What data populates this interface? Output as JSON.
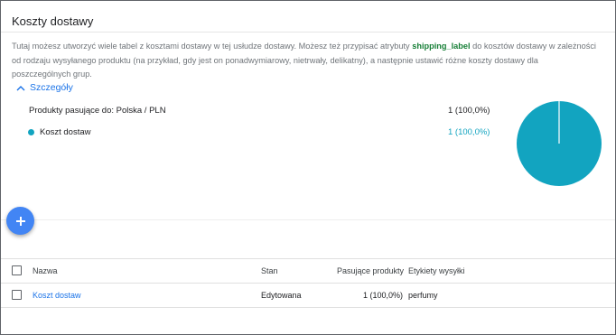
{
  "colors": {
    "accent": "#1a73e8",
    "series": "#12a4c0",
    "fab": "#4285f4",
    "attribute": "#188038"
  },
  "page": {
    "title": "Koszty dostawy",
    "description_before": "Tutaj możesz utworzyć wiele tabel z kosztami dostawy w tej usłudze dostawy. Możesz też przypisać atrybuty ",
    "description_attribute": "shipping_label",
    "description_after": " do kosztów dostawy w zależności od rodzaju wysyłanego produktu (na przykład, gdy jest on ponadwymiarowy, nietrwały, delikatny), a następnie ustawić różne koszty dostawy dla poszczególnych grup."
  },
  "details": {
    "toggle_label": "Szczegóły",
    "toggle_icon": "chevron-up-icon",
    "match_label": "Produkty pasujące do: Polska / PLN",
    "match_value": "1 (100,0%)",
    "legend_label": "Koszt dostaw",
    "legend_value": "1 (100,0%)"
  },
  "chart_data": {
    "type": "pie",
    "slices": [
      {
        "label": "Koszt dostaw",
        "value": 1,
        "percent": 100.0,
        "color": "#12a4c0"
      }
    ]
  },
  "fab": {
    "icon": "plus-icon"
  },
  "table": {
    "headers": {
      "name": "Nazwa",
      "state": "Stan",
      "matching": "Pasujące produkty",
      "labels": "Etykiety wysyłki"
    },
    "rows": [
      {
        "name": "Koszt dostaw",
        "state": "Edytowana",
        "matching": "1 (100,0%)",
        "labels": "perfumy"
      }
    ]
  }
}
